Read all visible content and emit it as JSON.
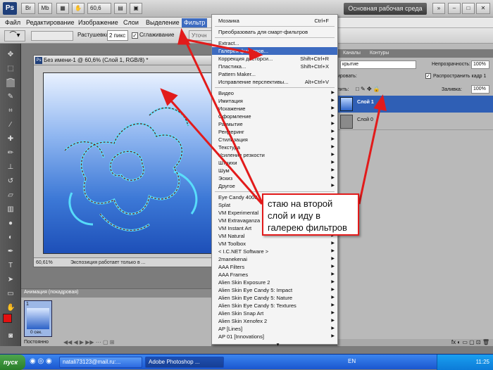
{
  "app": {
    "logo": "Ps",
    "mode_btn1": "Br",
    "mode_btn2": "Mb",
    "zoom_value": "60,6",
    "workspace": "Основная рабочая среда"
  },
  "menubar": [
    "Файл",
    "Редактирование",
    "Изображение",
    "Слои",
    "Выделение",
    "Фильтр"
  ],
  "options_bar": {
    "feather_label": "Растушевка:",
    "feather_value": "2 пикс",
    "antialias_label": "Сглаживание",
    "refine_label": "Уточн"
  },
  "document": {
    "title": "Без имени-1 @ 60,6% (Слой 1, RGB/8) *",
    "zoom": "60,61%",
    "status": "Экспозиция работает только в ..."
  },
  "filter_menu": {
    "group1": [
      {
        "label": "Мозаика",
        "shortcut": "Ctrl+F"
      }
    ],
    "group2": [
      {
        "label": "Преобразовать для смарт-фильтров"
      }
    ],
    "group3": [
      {
        "label": "Extract...",
        "shortcut": ""
      },
      {
        "label": "Галерея фильтров...",
        "shortcut": ""
      },
      {
        "label": "Коррекция дисторси...",
        "shortcut": "Shift+Ctrl+R"
      },
      {
        "label": "Пластика...",
        "shortcut": "Shift+Ctrl+X"
      },
      {
        "label": "Pattern Maker...",
        "shortcut": ""
      },
      {
        "label": "Исправление перспективы...",
        "shortcut": "Alt+Ctrl+V"
      }
    ],
    "group4": [
      "Видео",
      "Имитация",
      "Искажение",
      "Оформление",
      "Размытие",
      "Рендеринг",
      "Стилизация",
      "Текстура",
      "Усиление резкости",
      "Штрихи",
      "Шум",
      "Эскиз",
      "Другое"
    ],
    "group5": [
      "Eye Candy 4000",
      "Splat",
      "VM Experimental",
      "VM Extravaganza",
      "VM Instant Art",
      "VM Natural",
      "VM Toolbox",
      "< I.C.NET Software >",
      "2manekenai",
      "AAA Filters",
      "AAA Frames",
      "Alien Skin Exposure 2",
      "Alien Skin Eye Candy 5: Impact",
      "Alien Skin Eye Candy 5: Nature",
      "Alien Skin Eye Candy 5: Textures",
      "Alien Skin Snap Art",
      "Alien Skin Xenofex 2",
      "AP [Lines]",
      "AP 01 [Innovations]"
    ],
    "highlighted": "Галерея фильтров..."
  },
  "layers_panel": {
    "tabs": [
      "Каналы",
      "Контуры"
    ],
    "blend_mode": "крытие",
    "opacity_label": "Непрозрачность:",
    "opacity_value": "100%",
    "lock_label": "ировать:",
    "propagate_label": "Распространить кадр 1",
    "lock_prefix": "пить:",
    "fill_label": "Заливка:",
    "fill_value": "100%",
    "layers": [
      "Слой 1",
      "Слой 0"
    ]
  },
  "animation_panel": {
    "title": "Анимация (покадровая)",
    "frame_number": "1",
    "frame_delay": "0 сек.",
    "loop": "Постоянно"
  },
  "callout": {
    "text": "стаю на второй слой и иду в галерею фильтров"
  },
  "taskbar": {
    "start": "пуск",
    "tasks": [
      "natali73123@mail.ru:...",
      "Adobe Photoshop ..."
    ],
    "lang": "EN",
    "time": "11:25"
  },
  "colors": {
    "accent": "#3d6bc0",
    "annotation": "#e21b1b",
    "taskbar": "#2d6be0"
  }
}
